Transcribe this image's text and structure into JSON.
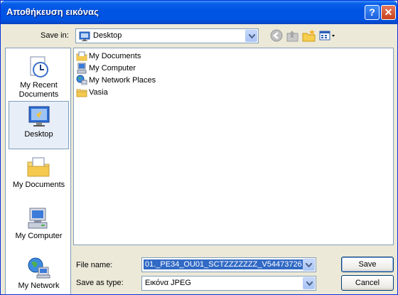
{
  "window": {
    "title": "Αποθήκευση εικόνας"
  },
  "titlebar_buttons": {
    "help": "?",
    "close": "✕"
  },
  "save_in": {
    "label": "Save in:",
    "value": "Desktop"
  },
  "toolbar": {
    "icons": [
      "back-icon",
      "up-folder-icon",
      "new-folder-icon",
      "views-menu-icon"
    ]
  },
  "places": [
    {
      "label": "My Recent Documents",
      "icon": "recent-documents-icon"
    },
    {
      "label": "Desktop",
      "icon": "desktop-icon",
      "selected": true
    },
    {
      "label": "My Documents",
      "icon": "my-documents-icon"
    },
    {
      "label": "My Computer",
      "icon": "my-computer-icon"
    },
    {
      "label": "My Network",
      "icon": "my-network-icon"
    }
  ],
  "files": [
    {
      "name": "My Documents",
      "icon": "my-documents-icon"
    },
    {
      "name": "My Computer",
      "icon": "my-computer-icon"
    },
    {
      "name": "My Network Places",
      "icon": "network-places-icon"
    },
    {
      "name": "Vasia",
      "icon": "folder-icon"
    }
  ],
  "file_name": {
    "label": "File name:",
    "value": "01._PE34_OU01_SCTZZZZZZZ_V54473726"
  },
  "save_as_type": {
    "label": "Save as type:",
    "value": "Εικόνα JPEG"
  },
  "buttons": {
    "save": "Save",
    "cancel": "Cancel"
  },
  "colors": {
    "title_bar": "#0054E3",
    "dialog_bg": "#ECE9D8",
    "selection": "#316AC5"
  }
}
